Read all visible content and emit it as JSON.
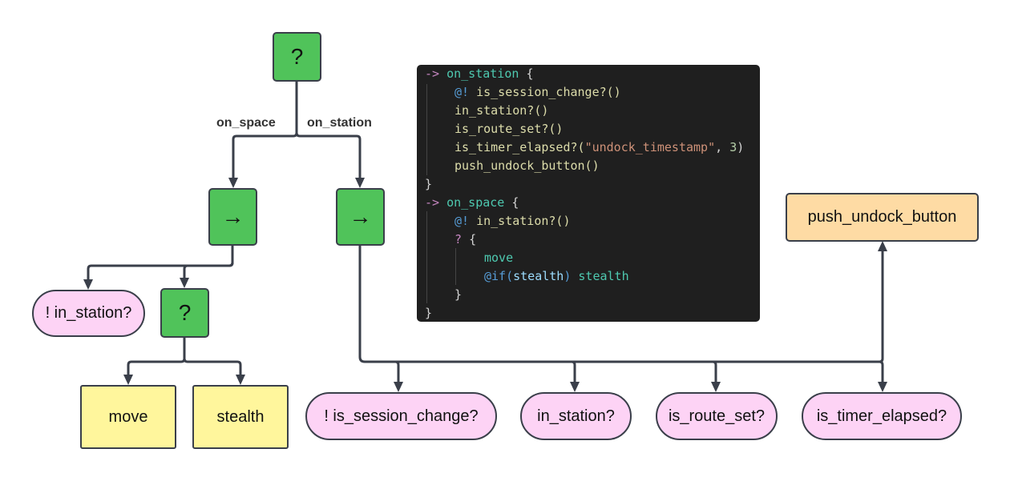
{
  "colors": {
    "control": "#50c35a",
    "condition": "#fdd3f5",
    "action": "#fff69c",
    "action_alt": "#fedba4",
    "edge": "#3a3f4a",
    "code_bg": "#1f1f1f"
  },
  "tree": {
    "root": "?",
    "seq_space": "→",
    "seq_station": "→",
    "edge_on_space": "on_space",
    "edge_on_station": "on_station",
    "not_in_station": "! in_station?",
    "selector": "?",
    "move": "move",
    "stealth": "stealth",
    "not_session_change": "! is_session_change?",
    "in_station": "in_station?",
    "route_set": "is_route_set?",
    "timer_elapsed": "is_timer_elapsed?",
    "push_undock": "push_undock_button"
  },
  "code": {
    "l1": {
      "arrow": "->",
      "name": "on_station",
      "brace": "{"
    },
    "l2": {
      "at": "@!",
      "call": "is_session_change?()"
    },
    "l3": {
      "call": "in_station?()"
    },
    "l4": {
      "call": "is_timer_elapsed?(",
      "str": "\"undock_timestamp\"",
      "sep": ", ",
      "num": "3",
      "close": ")"
    },
    "l4b": {
      "call": "is_route_set?()"
    },
    "l5": {
      "call": "push_undock_button()"
    },
    "l6": {
      "brace": "}"
    },
    "l7": {
      "arrow": "->",
      "name": "on_space",
      "brace": "{"
    },
    "l8": {
      "at": "@!",
      "call": "in_station?()"
    },
    "l9": {
      "q": "?",
      "brace": "{"
    },
    "l10": {
      "name": "move"
    },
    "l11": {
      "at": "@if(",
      "cond": "stealth",
      "close": ")",
      "name": "stealth"
    },
    "l12": {
      "brace": "}"
    },
    "l13": {
      "brace": "}"
    }
  }
}
